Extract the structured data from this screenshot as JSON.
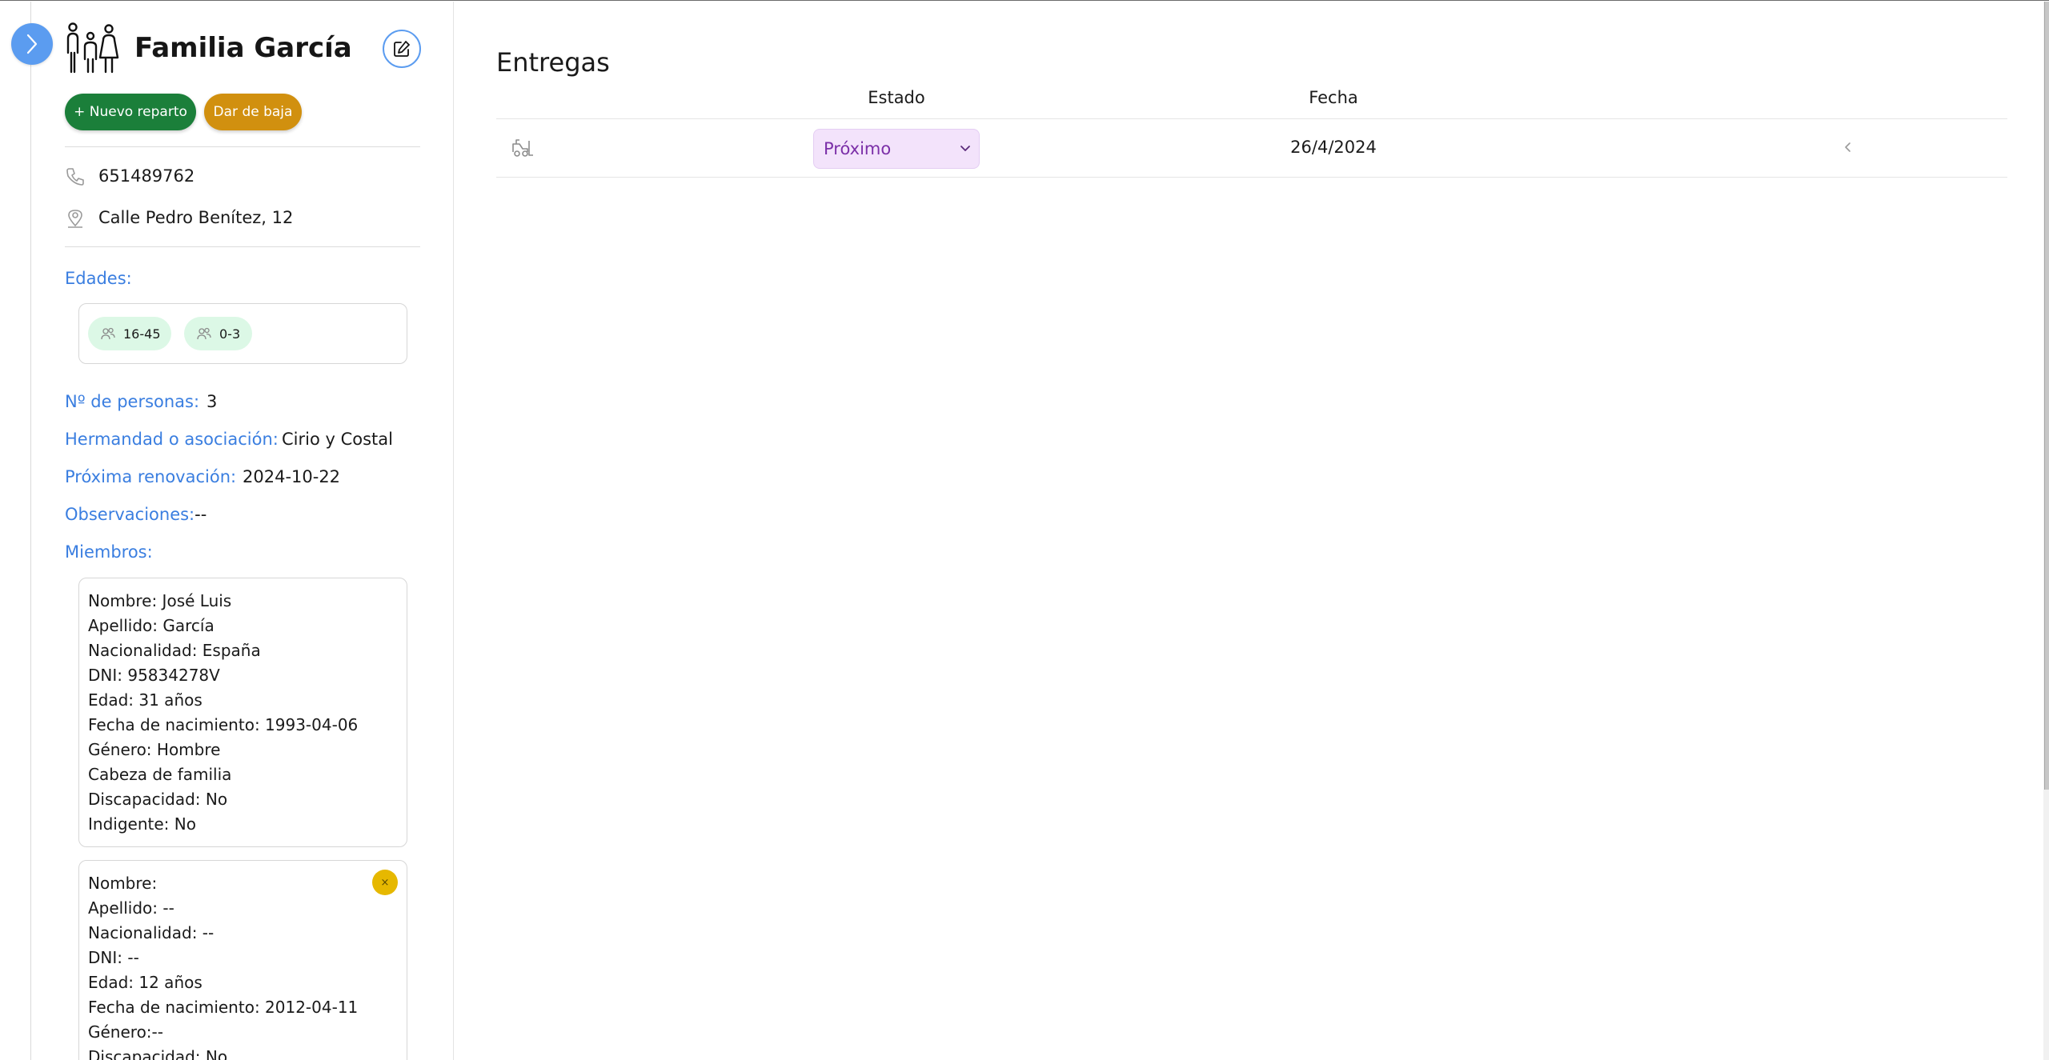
{
  "sidebar": {
    "title": "Familia García",
    "new_delivery_label": "+ Nuevo reparto",
    "deregister_label": "Dar de baja",
    "phone": "651489762",
    "address": "Calle Pedro Benítez, 12",
    "ages_label": "Edades:",
    "ages": [
      "16-45",
      "0-3"
    ],
    "people_count_label": "Nº de personas:",
    "people_count": "3",
    "brotherhood_label": "Hermandad o asociación:",
    "brotherhood": "Cirio y Costal",
    "renewal_label": "Próxima renovación:",
    "renewal": "2024-10-22",
    "observations_label": "Observaciones:",
    "observations": "--",
    "members_label": "Miembros:",
    "members": [
      {
        "lines": [
          "Nombre: José Luis",
          "Apellido: García",
          "Nacionalidad: España",
          "DNI: 95834278V",
          "Edad: 31 años",
          "Fecha de nacimiento: 1993-04-06",
          "Género: Hombre",
          "Cabeza de familia",
          "Discapacidad: No",
          "Indigente: No"
        ]
      },
      {
        "remove_label": "×",
        "lines": [
          "Nombre:",
          "Apellido: --",
          "Nacionalidad: --",
          "DNI: --",
          "Edad: 12 años",
          "Fecha de nacimiento: 2012-04-11",
          "Género:--",
          "Discapacidad: No"
        ]
      }
    ]
  },
  "main": {
    "title": "Entregas",
    "columns": [
      "Estado",
      "Fecha"
    ],
    "rows": [
      {
        "estado": "Próximo",
        "fecha": "26/4/2024"
      }
    ]
  },
  "icons": {
    "toggle": "chevron-right-icon",
    "family": "family-icon",
    "edit": "edit-icon",
    "phone": "phone-icon",
    "location": "location-pin-icon",
    "age": "people-icon",
    "delivery": "truck-icon",
    "row_action": "chevron-left-icon"
  },
  "colors": {
    "accent_blue": "#3a7ee0",
    "toggle_blue": "#5b9cf0",
    "new_button": "#1b7f3a",
    "deregister_button": "#d1900f",
    "age_chip": "#dcf8e6",
    "estado_bg": "#f3e3fb",
    "estado_text": "#7b2fa8",
    "remove_button": "#e6b800"
  }
}
